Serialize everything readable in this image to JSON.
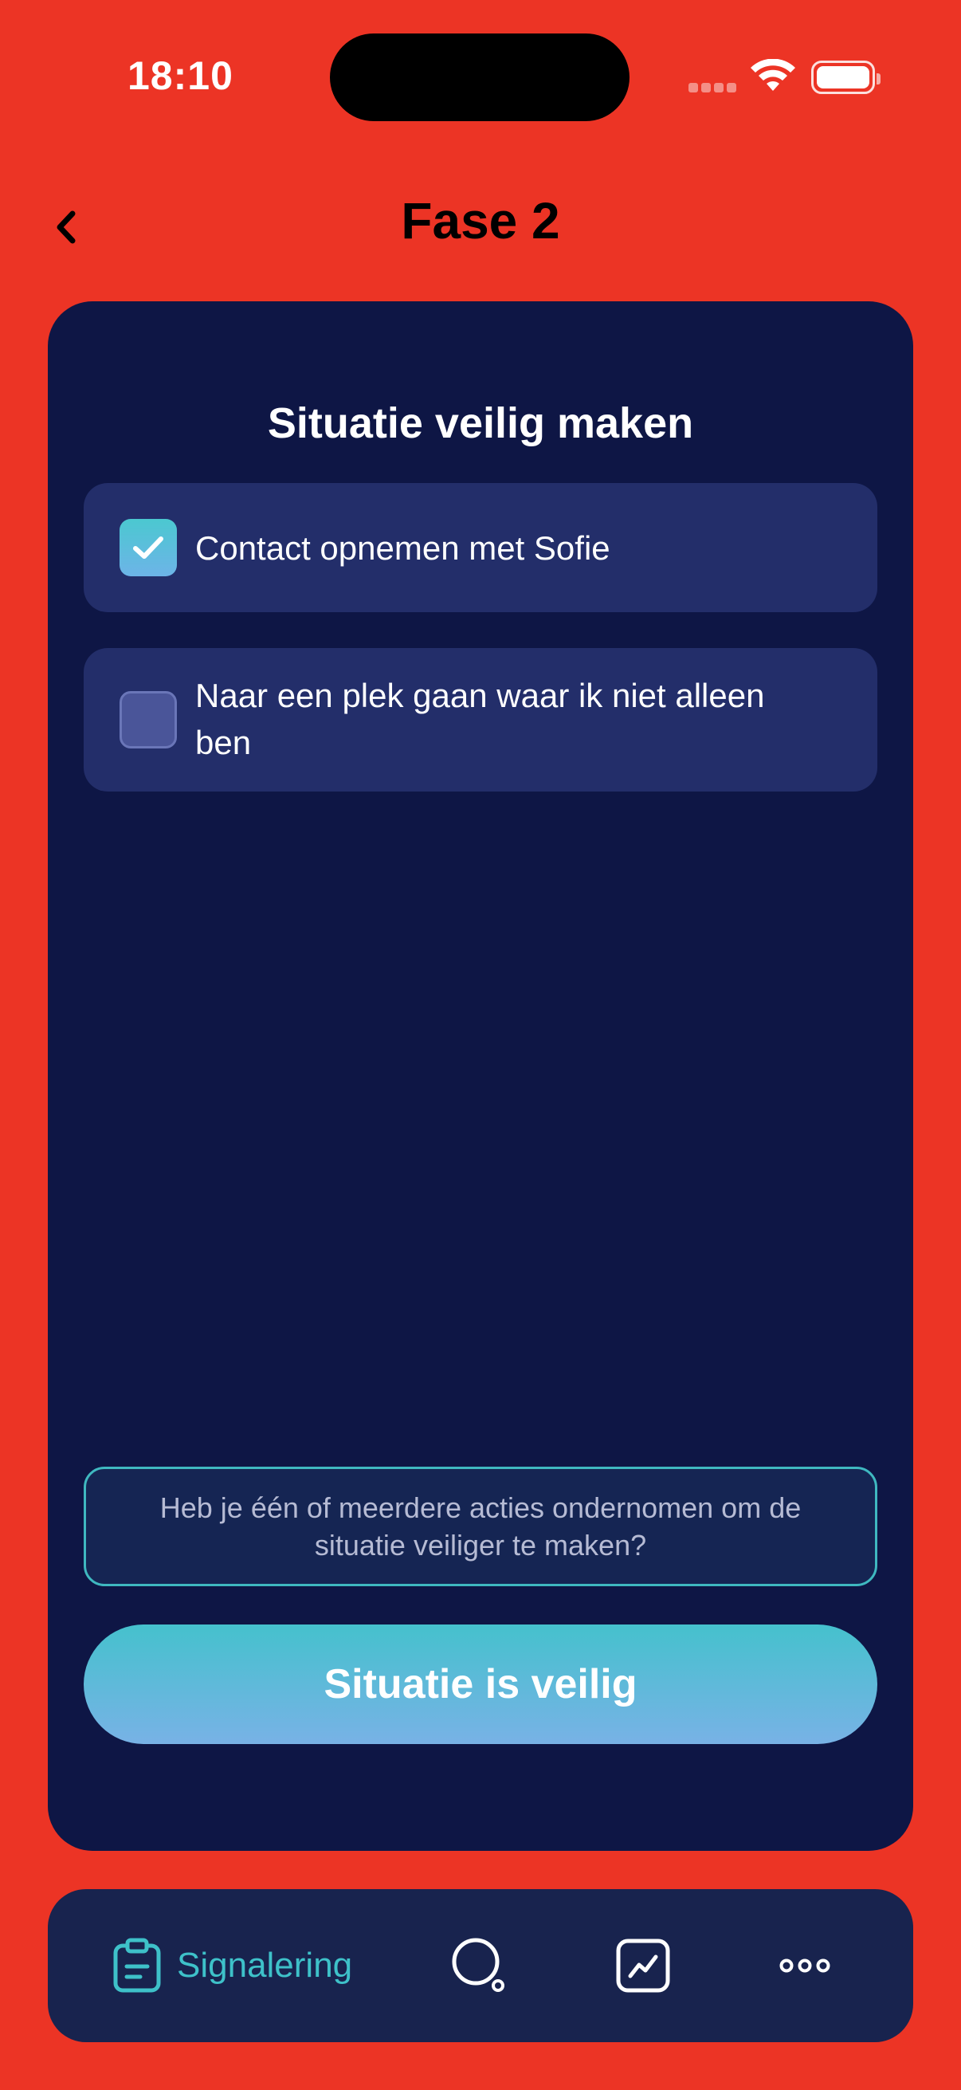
{
  "status_bar": {
    "time": "18:10"
  },
  "header": {
    "title": "Fase 2",
    "back_icon": "chevron-left-icon"
  },
  "card": {
    "title": "Situatie veilig maken",
    "items": [
      {
        "label": "Contact opnemen met Sofie",
        "checked": true
      },
      {
        "label": "Naar een plek gaan waar ik niet alleen ben",
        "checked": false
      }
    ],
    "question": "Heb je één of meerdere acties ondernomen om de situatie veiliger te maken?",
    "cta_label": "Situatie is veilig"
  },
  "tabbar": {
    "active": {
      "icon": "clipboard-icon",
      "label": "Signalering"
    },
    "tabs": [
      {
        "icon": "search-icon"
      },
      {
        "icon": "chart-icon"
      },
      {
        "icon": "more-icon"
      }
    ]
  },
  "colors": {
    "background": "#EC3425",
    "card": "#0E1645",
    "item": "#232E6A",
    "accent": "#3EC1C9",
    "tabbar": "#18234E"
  }
}
